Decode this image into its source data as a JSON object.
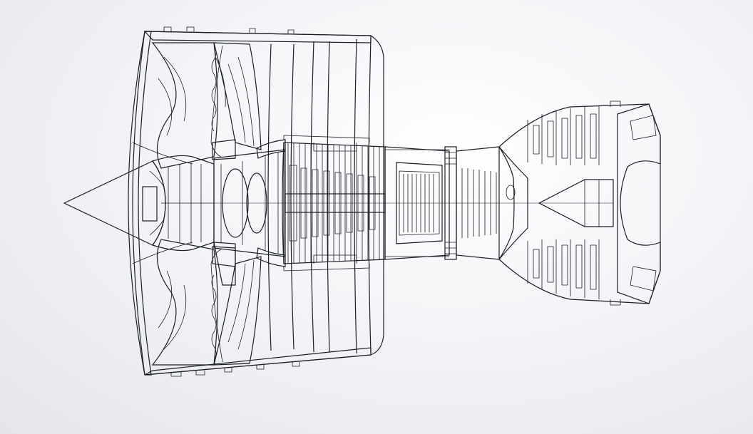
{
  "viewport": {
    "background": "#eef0f4",
    "model_color": "#8a8ea3",
    "model_shadow": "#5f6276",
    "model_highlight": "#b7bacb",
    "edge_color": "#1c1e26"
  }
}
